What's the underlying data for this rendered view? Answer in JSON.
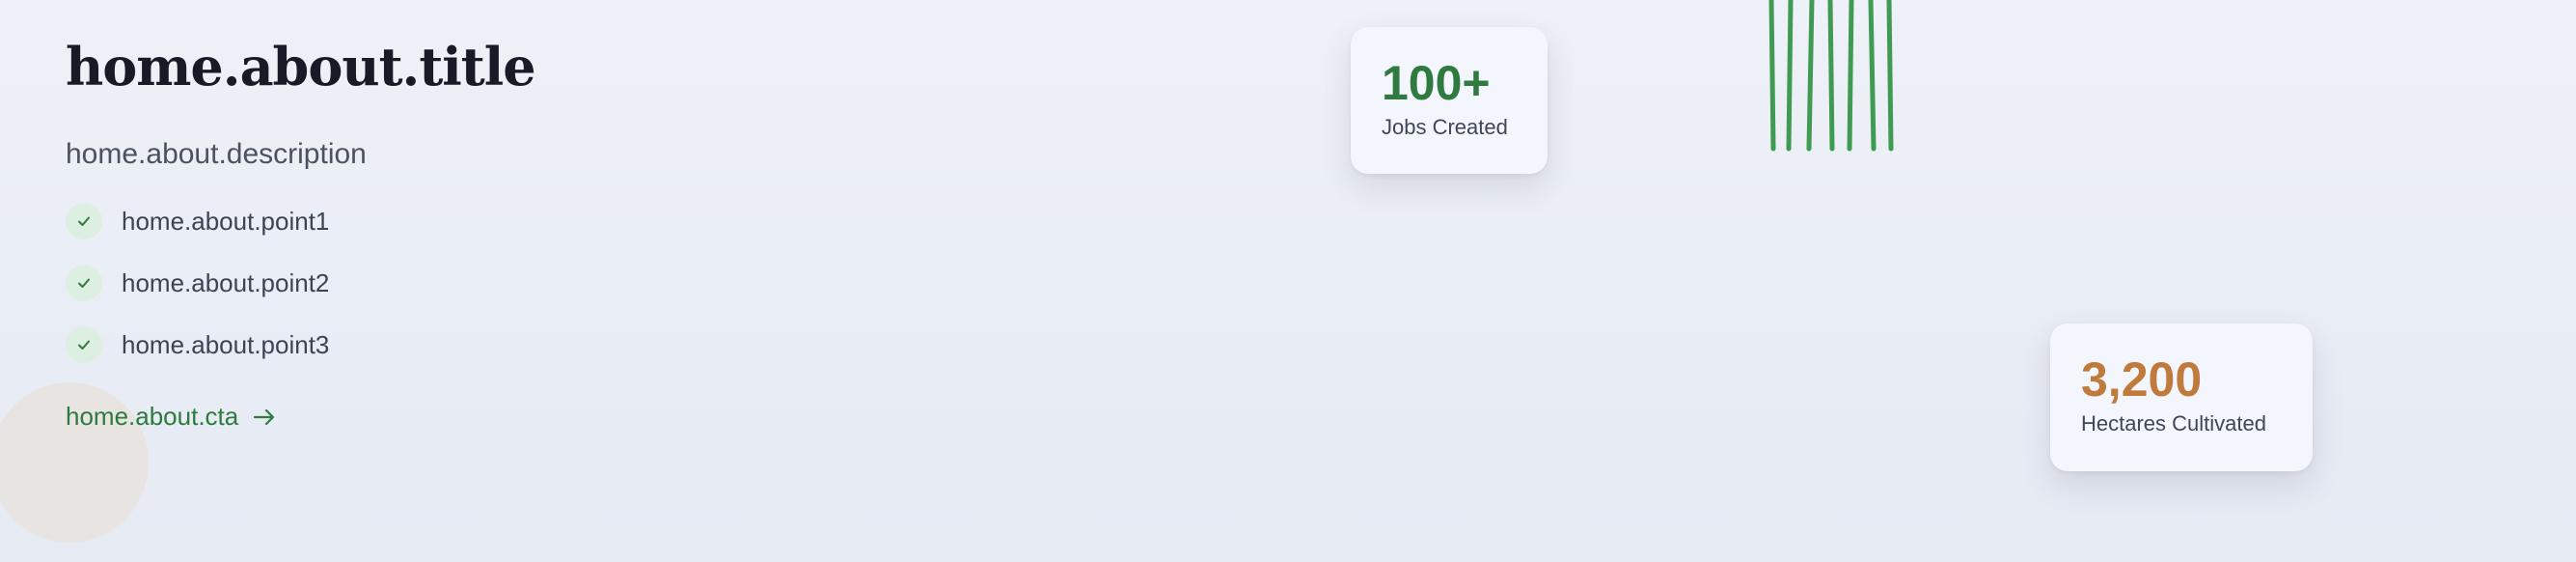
{
  "about": {
    "title": "home.about.title",
    "description": "home.about.description",
    "points": [
      "home.about.point1",
      "home.about.point2",
      "home.about.point3"
    ],
    "cta_label": "home.about.cta",
    "cta_icon": "arrow-right-icon",
    "point_icon": "check-icon"
  },
  "stats": {
    "jobs": {
      "value": "100+",
      "label": "Jobs Created"
    },
    "hectares": {
      "value": "3,200",
      "label": "Hectares Cultivated"
    }
  },
  "colors": {
    "brand_green": "#2f7a3e",
    "accent_orange": "#c07a3c",
    "title": "#161b26",
    "check_bg": "#dcefe0"
  }
}
